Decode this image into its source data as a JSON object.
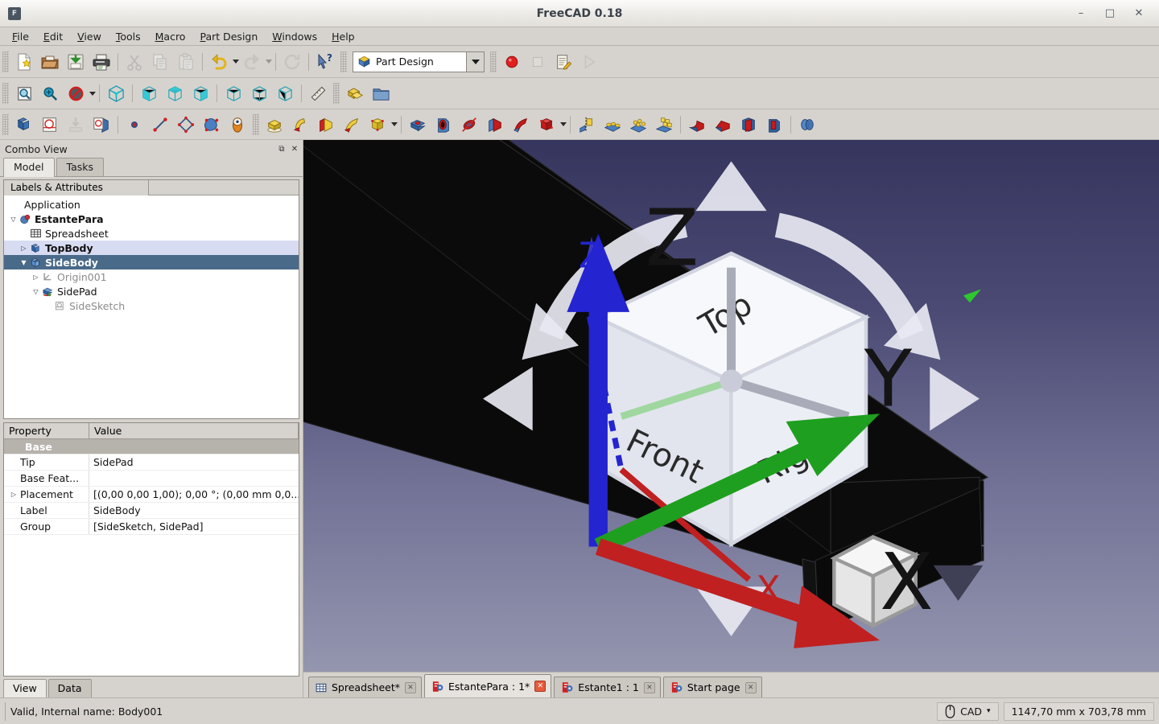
{
  "window": {
    "title": "FreeCAD 0.18",
    "app_icon": "freecad-app-icon",
    "minimize": "–",
    "maximize": "□",
    "close": "✕"
  },
  "menubar": {
    "items": [
      {
        "label": "File",
        "mnemonic": "F"
      },
      {
        "label": "Edit",
        "mnemonic": "E"
      },
      {
        "label": "View",
        "mnemonic": "V"
      },
      {
        "label": "Tools",
        "mnemonic": "T"
      },
      {
        "label": "Macro",
        "mnemonic": "M"
      },
      {
        "label": "Part Design",
        "mnemonic": "P"
      },
      {
        "label": "Windows",
        "mnemonic": "W"
      },
      {
        "label": "Help",
        "mnemonic": "H"
      }
    ]
  },
  "toolbars": {
    "file": [
      {
        "name": "new-document-icon",
        "title": "New"
      },
      {
        "name": "open-document-icon",
        "title": "Open"
      },
      {
        "name": "save-document-icon",
        "title": "Save"
      },
      {
        "name": "print-icon",
        "title": "Print"
      },
      {
        "name": "cut-icon",
        "title": "Cut",
        "disabled": true
      },
      {
        "name": "copy-icon",
        "title": "Copy",
        "disabled": true
      },
      {
        "name": "paste-icon",
        "title": "Paste",
        "disabled": true
      },
      {
        "name": "undo-icon",
        "title": "Undo"
      },
      {
        "name": "redo-icon",
        "title": "Redo",
        "disabled": true
      },
      {
        "name": "refresh-icon",
        "title": "Refresh",
        "disabled": true
      },
      {
        "name": "whats-this-icon",
        "title": "What's This"
      }
    ],
    "workbench": {
      "selected": "Part Design",
      "icon": "part-design-workbench-icon"
    },
    "macro": [
      {
        "name": "macro-record-icon",
        "title": "Macro recording"
      },
      {
        "name": "macro-stop-icon",
        "title": "Stop macro recording",
        "disabled": true
      },
      {
        "name": "macro-edit-icon",
        "title": "Macros"
      },
      {
        "name": "macro-execute-icon",
        "title": "Execute macro",
        "disabled": true
      }
    ],
    "view": [
      {
        "name": "fit-all-icon",
        "title": "Fit all"
      },
      {
        "name": "fit-selection-icon",
        "title": "Fit selection"
      },
      {
        "name": "draw-style-icon",
        "title": "Draw style"
      },
      {
        "name": "isometric-view-icon",
        "title": "Axonometric"
      },
      {
        "name": "front-view-icon",
        "title": "Front"
      },
      {
        "name": "top-view-icon",
        "title": "Top"
      },
      {
        "name": "right-view-icon",
        "title": "Right"
      },
      {
        "name": "rear-view-icon",
        "title": "Rear"
      },
      {
        "name": "bottom-view-icon",
        "title": "Bottom"
      },
      {
        "name": "left-view-icon",
        "title": "Left"
      },
      {
        "name": "measure-icon",
        "title": "Measure"
      },
      {
        "name": "create-part-icon",
        "title": "Create part"
      },
      {
        "name": "create-group-icon",
        "title": "Create group"
      }
    ],
    "partdesign": [
      {
        "name": "create-body-icon",
        "title": "Create body"
      },
      {
        "name": "create-sketch-icon",
        "title": "Create sketch"
      },
      {
        "name": "attach-sketch-icon",
        "title": "Attach sketch",
        "disabled": true
      },
      {
        "name": "edit-sketch-icon",
        "title": "Edit sketch"
      },
      {
        "name": "datum-point-icon",
        "title": "Create a datum point"
      },
      {
        "name": "datum-line-icon",
        "title": "Create a datum line"
      },
      {
        "name": "datum-plane-icon",
        "title": "Create a datum plane"
      },
      {
        "name": "shape-binder-icon",
        "title": "Create a shape binder"
      },
      {
        "name": "clone-icon",
        "title": "Create a sub-object shape binder"
      },
      {
        "name": "pad-icon",
        "title": "Pad"
      },
      {
        "name": "revolution-icon",
        "title": "Revolution"
      },
      {
        "name": "additive-loft-icon",
        "title": "Additive loft"
      },
      {
        "name": "additive-pipe-icon",
        "title": "Additive pipe"
      },
      {
        "name": "additive-box-icon",
        "title": "Additive primitive"
      },
      {
        "name": "pocket-icon",
        "title": "Pocket"
      },
      {
        "name": "hole-icon",
        "title": "Hole"
      },
      {
        "name": "groove-icon",
        "title": "Groove"
      },
      {
        "name": "subtractive-loft-icon",
        "title": "Subtractive loft"
      },
      {
        "name": "subtractive-pipe-icon",
        "title": "Subtractive pipe"
      },
      {
        "name": "subtractive-box-icon",
        "title": "Subtractive primitive"
      },
      {
        "name": "mirrored-icon",
        "title": "Mirrored"
      },
      {
        "name": "linear-pattern-icon",
        "title": "Linear pattern"
      },
      {
        "name": "polar-pattern-icon",
        "title": "Polar pattern"
      },
      {
        "name": "multi-transform-icon",
        "title": "Create MultiTransform"
      },
      {
        "name": "fillet-icon",
        "title": "Fillet"
      },
      {
        "name": "chamfer-icon",
        "title": "Chamfer"
      },
      {
        "name": "draft-icon",
        "title": "Draft"
      },
      {
        "name": "thickness-icon",
        "title": "Thickness"
      },
      {
        "name": "boolean-icon",
        "title": "Boolean operation"
      }
    ]
  },
  "combo_view": {
    "title": "Combo View",
    "float_btn": "⧉",
    "close_btn": "✕",
    "tabs": [
      {
        "label": "Model",
        "active": true
      },
      {
        "label": "Tasks",
        "active": false
      }
    ],
    "tree_column_header": "Labels & Attributes",
    "tree": [
      {
        "label": "Application",
        "indent": 0,
        "twisty": "",
        "icon": "",
        "state": "plain",
        "bold": false
      },
      {
        "label": "EstantePara",
        "indent": 1,
        "twisty": "▽",
        "icon": "document-icon",
        "state": "plain",
        "bold": true
      },
      {
        "label": "Spreadsheet",
        "indent": 2,
        "twisty": "",
        "icon": "spreadsheet-icon",
        "state": "plain",
        "bold": false
      },
      {
        "label": "TopBody",
        "indent": 1,
        "twisty": "▷",
        "icon": "body-icon",
        "state": "highlight",
        "bold": true
      },
      {
        "label": "SideBody",
        "indent": 1,
        "twisty": "▼",
        "icon": "body-icon",
        "state": "selected",
        "bold": true
      },
      {
        "label": "Origin001",
        "indent": 2,
        "twisty": "▷",
        "icon": "origin-icon",
        "state": "dim",
        "bold": false
      },
      {
        "label": "SidePad",
        "indent": 2,
        "twisty": "▽",
        "icon": "pad-feature-icon",
        "state": "plain",
        "bold": false
      },
      {
        "label": "SideSketch",
        "indent": 3,
        "twisty": "",
        "icon": "sketch-icon",
        "state": "dim",
        "bold": false
      }
    ],
    "property_headers": {
      "property": "Property",
      "value": "Value"
    },
    "properties": [
      {
        "group": "Base"
      },
      {
        "name": "Tip",
        "value": "SidePad",
        "expandable": false
      },
      {
        "name": "Base Feat...",
        "value": "",
        "expandable": false
      },
      {
        "name": "Placement",
        "value": "[(0,00 0,00 1,00); 0,00 °; (0,00 mm  0,0...",
        "expandable": true
      },
      {
        "name": "Label",
        "value": "SideBody",
        "expandable": false
      },
      {
        "name": "Group",
        "value": "[SideSketch, SidePad]",
        "expandable": false
      }
    ],
    "bottom_tabs": [
      {
        "label": "View",
        "active": true
      },
      {
        "label": "Data",
        "active": false
      }
    ]
  },
  "viewport": {
    "background_top": "#36355e",
    "background_bottom": "#9496af",
    "model_color": "#0a0a0a",
    "navcube": {
      "faces": [
        "Top",
        "Front",
        "Right"
      ],
      "axis_z_label": "Z",
      "axis_x_label": "X",
      "corner_cube": "view-cube-toggle"
    },
    "axis_indicator": {
      "x": "X",
      "y": "Y",
      "z": "Z"
    },
    "origin_arrow_color": "#3a39c8"
  },
  "mdi_tabs": [
    {
      "label": "Spreadsheet*",
      "icon": "spreadsheet-icon",
      "active": false
    },
    {
      "label": "EstantePara : 1*",
      "icon": "freecad-doc-icon",
      "active": true
    },
    {
      "label": "Estante1 : 1",
      "icon": "freecad-doc-icon",
      "active": false
    },
    {
      "label": "Start page",
      "icon": "freecad-doc-icon",
      "active": false
    }
  ],
  "statusbar": {
    "message": "Valid, Internal name: Body001",
    "nav_style": "CAD",
    "nav_icon": "mouse-icon",
    "nav_caret": "▾",
    "dimensions": "1147,70 mm x 703,78 mm"
  }
}
